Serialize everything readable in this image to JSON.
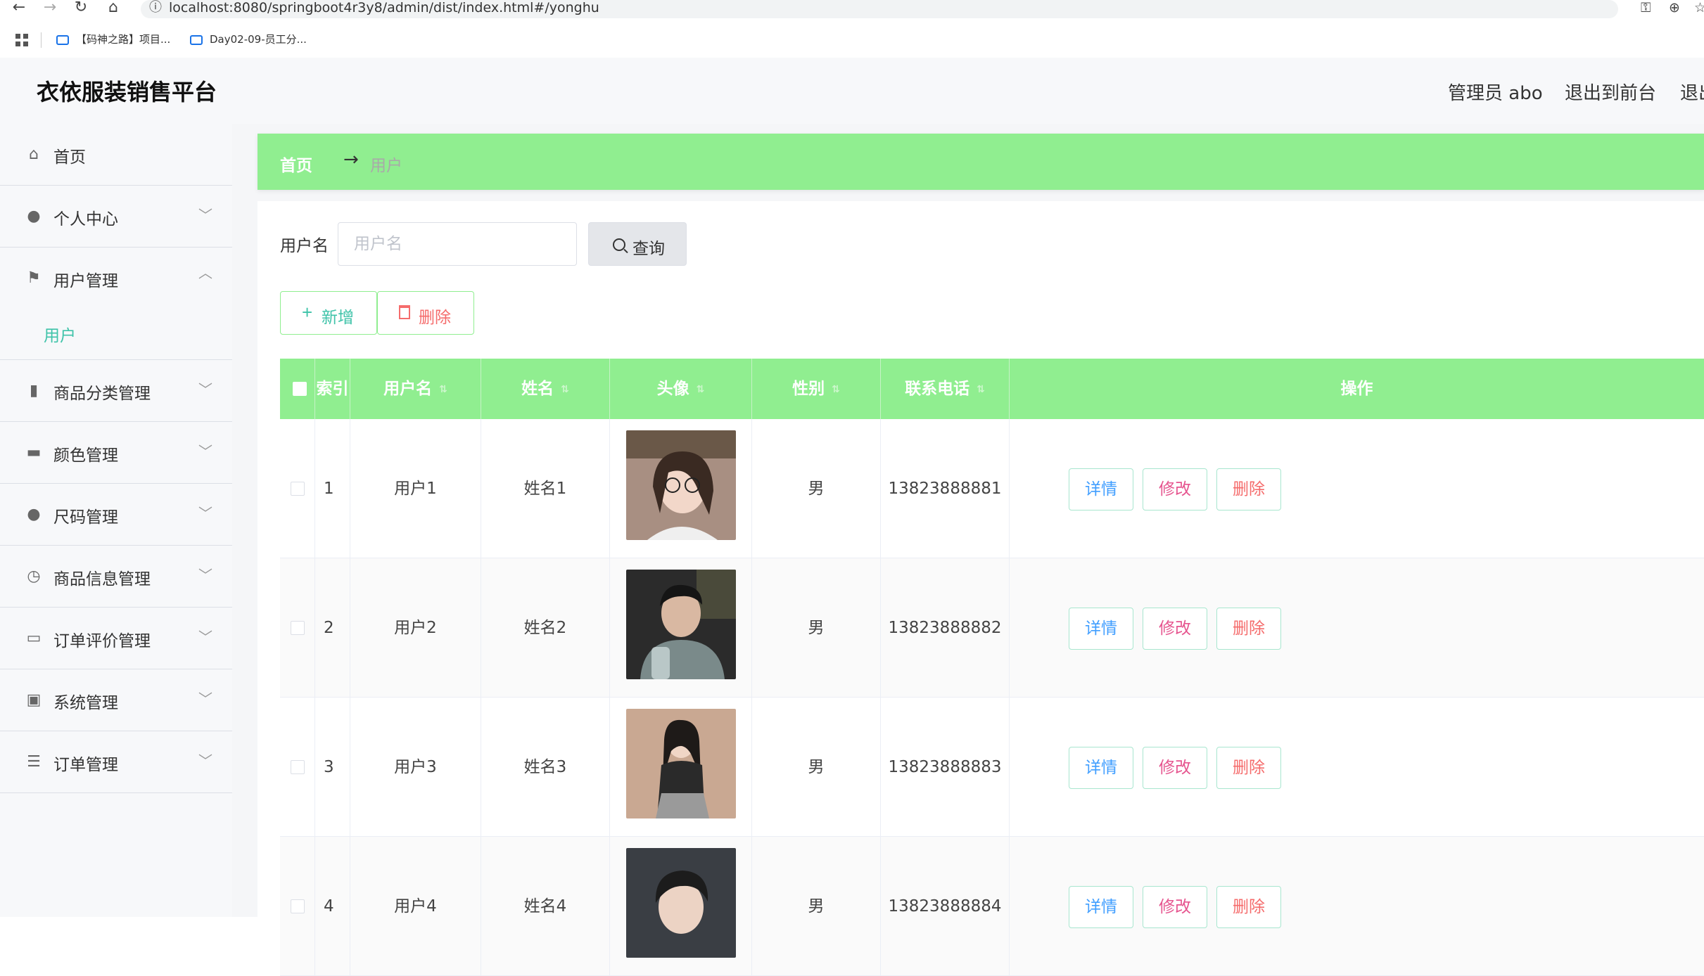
{
  "browser": {
    "url": "localhost:8080/springboot4r3y8/admin/dist/index.html#/yonghu",
    "bookmarks": [
      "【码神之路】项目...",
      "Day02-09-员工分..."
    ]
  },
  "header": {
    "title": "衣依服装销售平台",
    "admin_label": "管理员 abo",
    "exit_front": "退出到前台",
    "logout": "退出登录"
  },
  "sidebar": {
    "items": [
      {
        "label": "首页",
        "icon": "home-icon",
        "has_chevron": false
      },
      {
        "label": "个人中心",
        "icon": "user-icon",
        "has_chevron": true
      },
      {
        "label": "用户管理",
        "icon": "flag-icon",
        "has_chevron": true,
        "expanded": true
      },
      {
        "label": "商品分类管理",
        "icon": "bar-chart-icon",
        "has_chevron": true
      },
      {
        "label": "颜色管理",
        "icon": "monitor-icon",
        "has_chevron": true
      },
      {
        "label": "尺码管理",
        "icon": "bulb-icon",
        "has_chevron": true
      },
      {
        "label": "商品信息管理",
        "icon": "clock-icon",
        "has_chevron": true
      },
      {
        "label": "订单评价管理",
        "icon": "chat-icon",
        "has_chevron": true
      },
      {
        "label": "系统管理",
        "icon": "clipboard-icon",
        "has_chevron": true
      },
      {
        "label": "订单管理",
        "icon": "list-icon",
        "has_chevron": true
      }
    ],
    "sub_item": "用户"
  },
  "breadcrumb": {
    "home": "首页",
    "arrow": "→",
    "current": "用户"
  },
  "search": {
    "label": "用户名",
    "placeholder": "用户名",
    "button": "查询"
  },
  "actions": {
    "add": "新增",
    "delete": "删除"
  },
  "table": {
    "columns": [
      "索引",
      "用户名",
      "姓名",
      "头像",
      "性别",
      "联系电话",
      "操作"
    ],
    "row_actions": {
      "view": "详情",
      "edit": "修改",
      "delete": "删除"
    },
    "rows": [
      {
        "index": "1",
        "username": "用户1",
        "name": "姓名1",
        "gender": "男",
        "phone": "13823888881"
      },
      {
        "index": "2",
        "username": "用户2",
        "name": "姓名2",
        "gender": "男",
        "phone": "13823888882"
      },
      {
        "index": "3",
        "username": "用户3",
        "name": "姓名3",
        "gender": "男",
        "phone": "13823888883"
      },
      {
        "index": "4",
        "username": "用户4",
        "name": "姓名4",
        "gender": "男",
        "phone": "13823888884"
      }
    ]
  },
  "colors": {
    "accent": "#90ee90",
    "link": "#3fc3a9",
    "danger": "#f56c6c"
  }
}
